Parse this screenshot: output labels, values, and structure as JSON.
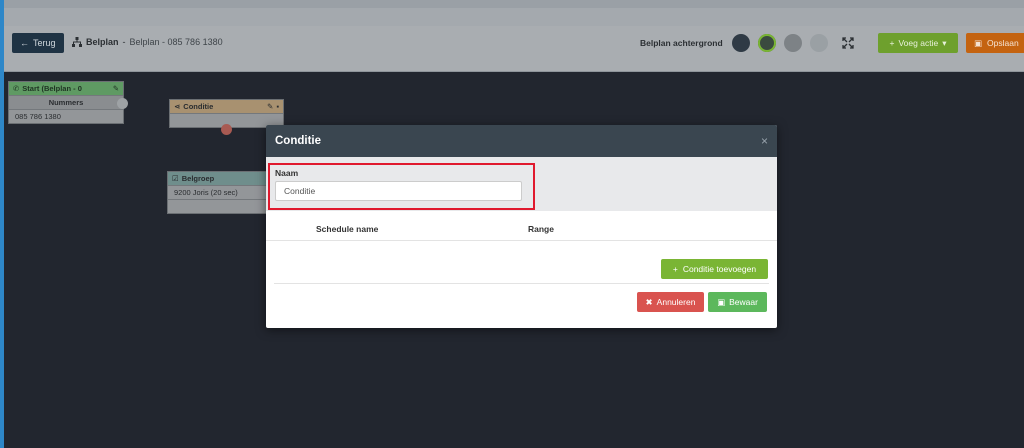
{
  "toolbar": {
    "back_label": "Terug",
    "plan_label": "Belplan",
    "plan_name": "Belplan - 085 786 1380",
    "background_label": "Belplan achtergrond",
    "background_colors": [
      "#2f3a45",
      "#3a4a3f",
      "#7d8286",
      "#9aa0a4"
    ],
    "add_action_label": "Voeg actie",
    "save_label": "Opslaan"
  },
  "canvas": {
    "start_node": {
      "title": "Start (Belplan - 0",
      "section": "Nummers",
      "number": "085 786 1380"
    },
    "condition_node": {
      "title": "Conditie"
    },
    "group_node": {
      "title": "Belgroep",
      "member": "9200 Joris (20 sec)"
    }
  },
  "modal": {
    "title": "Conditie",
    "close": "×",
    "name_label": "Naam",
    "name_value": "Conditie",
    "columns": [
      "Schedule name",
      "Range"
    ],
    "add_condition_label": "Conditie toevoegen",
    "cancel_label": "Annuleren",
    "submit_label": "Bewaar"
  }
}
